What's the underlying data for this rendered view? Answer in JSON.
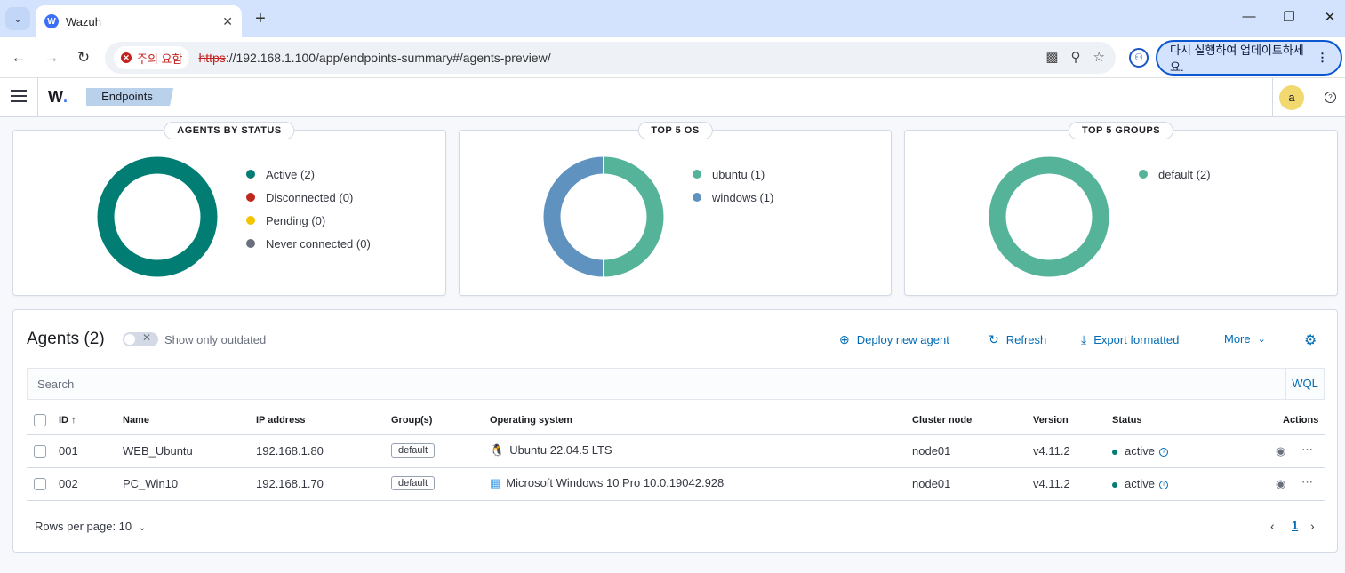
{
  "browser": {
    "tab_title": "Wazuh",
    "favicon_letter": "W",
    "security_warning": "주의 요함",
    "url_scheme": "https",
    "url_rest": "://192.168.1.100/app/endpoints-summary#/agents-preview/",
    "update_button": "다시 실행하여 업데이트하세요.",
    "profile_initial": "⚇"
  },
  "header": {
    "logo_text": "W",
    "logo_dot": ".",
    "breadcrumb": "Endpoints",
    "avatar_initial": "a",
    "help_symbol": "?"
  },
  "panels": {
    "status": {
      "title": "AGENTS BY STATUS",
      "legend": [
        {
          "label": "Active (2)",
          "color": "#017d73"
        },
        {
          "label": "Disconnected (0)",
          "color": "#bd271e"
        },
        {
          "label": "Pending (0)",
          "color": "#f5c400"
        },
        {
          "label": "Never connected (0)",
          "color": "#69707d"
        }
      ]
    },
    "os": {
      "title": "TOP 5 OS",
      "legend": [
        {
          "label": "ubuntu (1)",
          "color": "#54b399"
        },
        {
          "label": "windows (1)",
          "color": "#6092c0"
        }
      ]
    },
    "groups": {
      "title": "TOP 5 GROUPS",
      "legend": [
        {
          "label": "default (2)",
          "color": "#54b399"
        }
      ]
    }
  },
  "agents": {
    "title": "Agents (2)",
    "toggle_label": "Show only outdated",
    "deploy": "Deploy new agent",
    "refresh": "Refresh",
    "export": "Export formatted",
    "more": "More",
    "search_placeholder": "Search",
    "wql": "WQL",
    "columns": {
      "id": "ID",
      "name": "Name",
      "ip": "IP address",
      "groups": "Group(s)",
      "os": "Operating system",
      "cluster": "Cluster node",
      "version": "Version",
      "status": "Status",
      "actions": "Actions"
    },
    "rows": [
      {
        "id": "001",
        "name": "WEB_Ubuntu",
        "ip": "192.168.1.80",
        "group": "default",
        "os": "Ubuntu 22.04.5 LTS",
        "os_icon": "linux-icon",
        "cluster": "node01",
        "version": "v4.11.2",
        "status": "active"
      },
      {
        "id": "002",
        "name": "PC_Win10",
        "ip": "192.168.1.70",
        "group": "default",
        "os": "Microsoft Windows 10 Pro 10.0.19042.928",
        "os_icon": "windows-icon",
        "cluster": "node01",
        "version": "v4.11.2",
        "status": "active"
      }
    ],
    "rows_per_page": "Rows per page: 10",
    "current_page": "1"
  }
}
